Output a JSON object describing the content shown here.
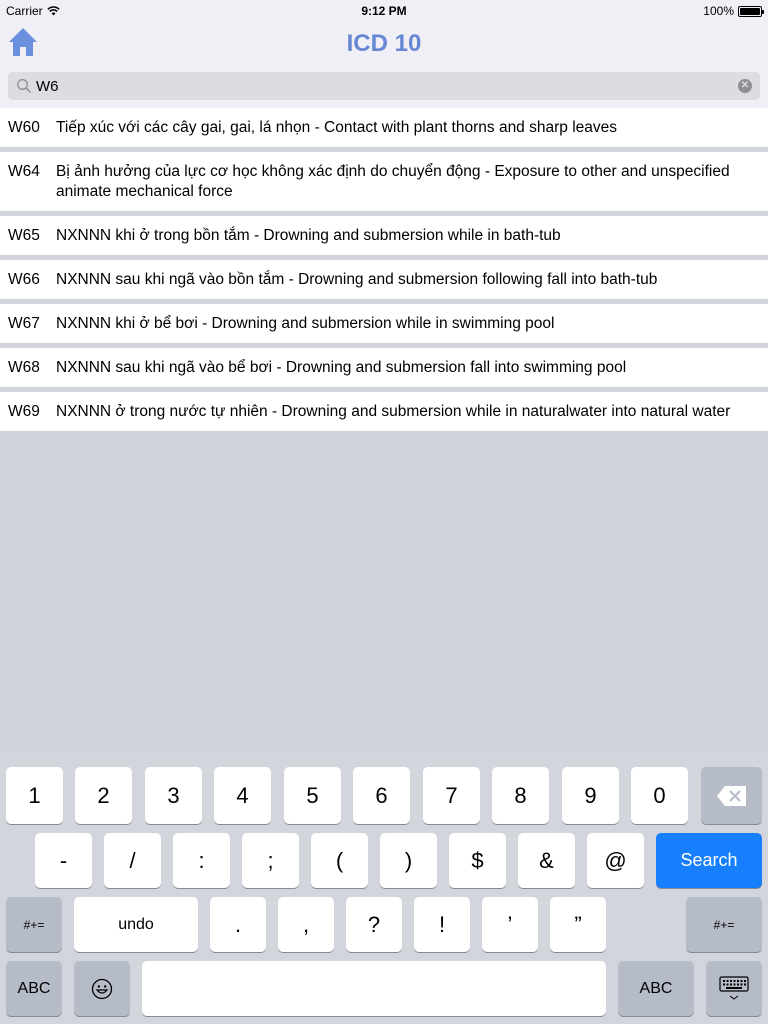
{
  "status_bar": {
    "carrier": "Carrier",
    "time": "9:12 PM",
    "battery": "100%"
  },
  "nav": {
    "title": "ICD 10",
    "home_icon": "home-icon"
  },
  "search": {
    "value": "W6",
    "placeholder": "",
    "search_icon": "search-icon",
    "clear_icon": "clear-icon"
  },
  "results": [
    {
      "code": "W60",
      "text": "Tiếp xúc với các cây gai, gai, lá nhọn  - Contact with plant thorns and sharp leaves"
    },
    {
      "code": "W64",
      "text": "Bị ảnh hưởng của lực cơ học không xác định do chuyển động  - Exposure to other and unspecified animate mechanical force"
    },
    {
      "code": "W65",
      "text": "NXNNN khi ở trong bồn tắm  - Drowning and submersion while in bath-tub"
    },
    {
      "code": "W66",
      "text": "NXNNN sau khi ngã vào bồn tắm  - Drowning and submersion following fall into bath-tub"
    },
    {
      "code": "W67",
      "text": "NXNNN khi ở bể bơi  - Drowning and submersion while in swimming pool"
    },
    {
      "code": "W68",
      "text": "NXNNN sau khi ngã vào bể bơi  - Drowning and submersion fall into swimming pool"
    },
    {
      "code": "W69",
      "text": "NXNNN ở trong nước tự nhiên  - Drowning and submersion while in naturalwater into natural water"
    }
  ],
  "keyboard": {
    "row1": [
      "1",
      "2",
      "3",
      "4",
      "5",
      "6",
      "7",
      "8",
      "9",
      "0"
    ],
    "backspace_icon": "backspace-icon",
    "row2": [
      "-",
      "/",
      ":",
      ";",
      "(",
      ")",
      "$",
      "&",
      "@"
    ],
    "search_label": "Search",
    "row3_left": "#+=",
    "undo_label": "undo",
    "row3": [
      ".",
      ",",
      "?",
      "!",
      "’",
      "”"
    ],
    "row3_right": "#+=",
    "abc_left": "ABC",
    "emoji_icon": "emoji-icon",
    "space_label": "",
    "abc_right": "ABC",
    "dismiss_icon": "keyboard-dismiss-icon"
  },
  "colors": {
    "accent": "#6687d4",
    "search_key": "#177ffb",
    "background": "#d2d4dc"
  }
}
